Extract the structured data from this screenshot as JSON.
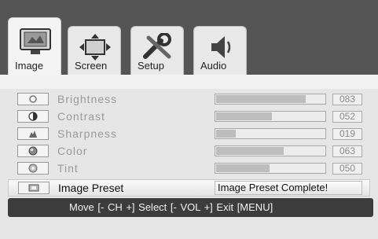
{
  "tabs": [
    {
      "label": "Image",
      "icon": "tv-icon",
      "active": true
    },
    {
      "label": "Screen",
      "icon": "move-arrows-icon",
      "active": false
    },
    {
      "label": "Setup",
      "icon": "wrench-icon",
      "active": false
    },
    {
      "label": "Audio",
      "icon": "speaker-icon",
      "active": false
    }
  ],
  "settings": [
    {
      "label": "Brightness",
      "value": "083",
      "level": 83,
      "icon": "sun-icon"
    },
    {
      "label": "Contrast",
      "value": "052",
      "level": 52,
      "icon": "contrast-icon"
    },
    {
      "label": "Sharpness",
      "value": "019",
      "level": 19,
      "icon": "sharpness-icon"
    },
    {
      "label": "Color",
      "value": "063",
      "level": 63,
      "icon": "color-icon"
    },
    {
      "label": "Tint",
      "value": "050",
      "level": 50,
      "icon": "tint-icon"
    }
  ],
  "preset": {
    "label": "Image Preset",
    "status": "Image Preset Complete!",
    "icon": "preset-icon"
  },
  "help": {
    "text": "Move [- CH +]   Select [- VOL +]   Exit [MENU]"
  },
  "colors": {
    "top_bar": "#555555",
    "help_bar": "#3c3c3c",
    "bar_fill": "#bdbdbd"
  }
}
